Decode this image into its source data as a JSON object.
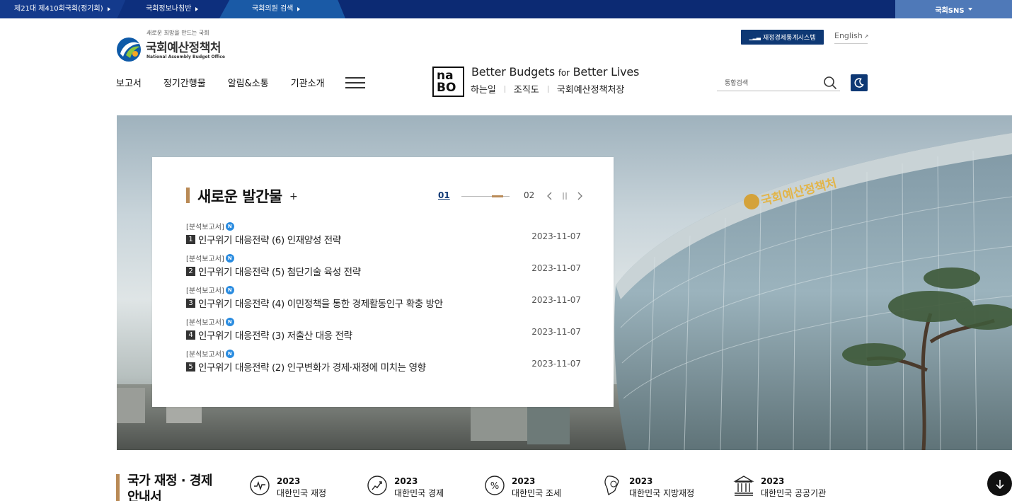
{
  "topbar": {
    "tab1": "제21대 제410회국회(정기회)",
    "tab2": "국회정보나침반",
    "tab3": "국회의원 검색",
    "sns": "국회SNS"
  },
  "logo": {
    "slogan": "새로운 희망을 만드는 국회",
    "name": "국회예산정책처",
    "english": "National Assembly Budget Office"
  },
  "header": {
    "stat_button": "재정경제통계시스템",
    "english_link": "English"
  },
  "gnb": [
    "보고서",
    "정기간행물",
    "알림&소통",
    "기관소개"
  ],
  "nabo": {
    "box_line1": "na",
    "box_line2": "BO",
    "slogan_a": "Better Budgets ",
    "slogan_for": "for",
    "slogan_b": " Better Lives",
    "links": [
      "하는일",
      "조직도",
      "국회예산정책처장"
    ]
  },
  "search": {
    "placeholder": "통합검색"
  },
  "publications": {
    "title": "새로운 발간물",
    "plus": "+",
    "page_current": "01",
    "page_next": "02",
    "items": [
      {
        "category": "[분석보고서]",
        "badge": "N",
        "num": "1",
        "title": "인구위기 대응전략 (6) 인재양성 전략",
        "date": "2023-11-07"
      },
      {
        "category": "[분석보고서]",
        "badge": "N",
        "num": "2",
        "title": "인구위기 대응전략 (5) 첨단기술 육성 전략",
        "date": "2023-11-07"
      },
      {
        "category": "[분석보고서]",
        "badge": "N",
        "num": "3",
        "title": "인구위기 대응전략 (4) 이민정책을 통한 경제활동인구 확충 방안",
        "date": "2023-11-07"
      },
      {
        "category": "[분석보고서]",
        "badge": "N",
        "num": "4",
        "title": "인구위기 대응전략 (3) 저출산 대응 전략",
        "date": "2023-11-07"
      },
      {
        "category": "[분석보고서]",
        "badge": "N",
        "num": "5",
        "title": "인구위기 대응전략 (2) 인구변화가 경제·재정에 미치는 영향",
        "date": "2023-11-07"
      }
    ]
  },
  "hero": {
    "building_sign": "국회예산정책처"
  },
  "guide": {
    "title_line1": "국가 재정 · 경제",
    "title_line2": "안내서",
    "items": [
      {
        "year": "2023",
        "label": "대한민국 재정",
        "icon": "finance-icon"
      },
      {
        "year": "2023",
        "label": "대한민국 경제",
        "icon": "economy-chart-icon"
      },
      {
        "year": "2023",
        "label": "대한민국 조세",
        "icon": "percent-icon"
      },
      {
        "year": "2023",
        "label": "대한민국 지방재정",
        "icon": "korea-map-icon"
      },
      {
        "year": "2023",
        "label": "대한민국 공공기관",
        "icon": "institution-icon"
      }
    ]
  },
  "colors": {
    "navy": "#0e3874",
    "accent": "#b98a56",
    "topbar": "#0c2a73",
    "new_badge": "#2a8ce0"
  }
}
